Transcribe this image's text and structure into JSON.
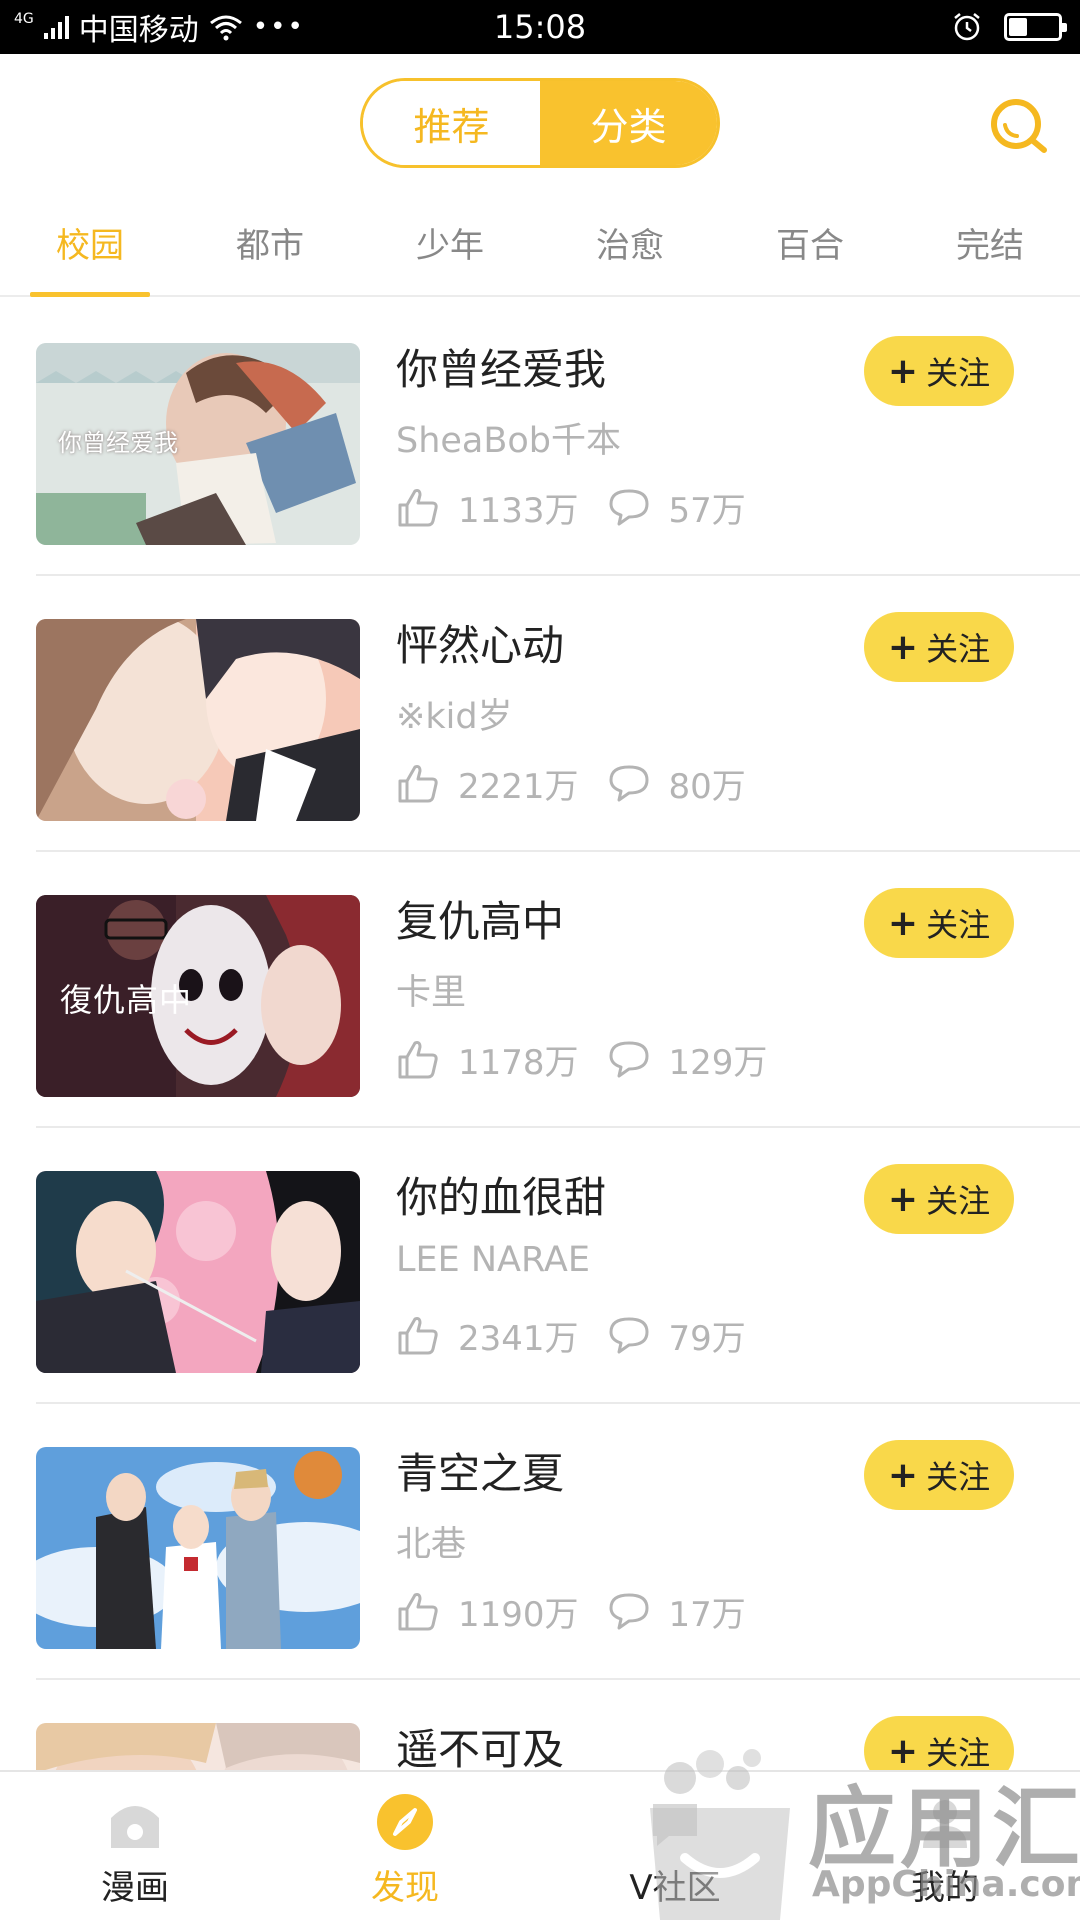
{
  "status_bar": {
    "network": "4G",
    "carrier": "中国移动",
    "dots": "•••",
    "time": "15:08",
    "battery_level": 0.35
  },
  "header": {
    "segments": [
      "推荐",
      "分类"
    ],
    "active_segment": "分类",
    "search_icon": "search-icon"
  },
  "tabs": [
    "校园",
    "都市",
    "少年",
    "治愈",
    "百合",
    "完结"
  ],
  "active_tab": "校园",
  "comics": [
    {
      "title": "你曾经爱我",
      "author": "SheaBob千本",
      "likes": "1133万",
      "comments": "57万",
      "follow": "关注",
      "cover_text": "你曾经爱我"
    },
    {
      "title": "怦然心动",
      "author": "※kid岁",
      "likes": "2221万",
      "comments": "80万",
      "follow": "关注",
      "cover_text": ""
    },
    {
      "title": "复仇高中",
      "author": "卡里",
      "likes": "1178万",
      "comments": "129万",
      "follow": "关注",
      "cover_text": "復仇高中"
    },
    {
      "title": "你的血很甜",
      "author": "LEE NARAE",
      "likes": "2341万",
      "comments": "79万",
      "follow": "关注",
      "cover_text": ""
    },
    {
      "title": "青空之夏",
      "author": "北巷",
      "likes": "1190万",
      "comments": "17万",
      "follow": "关注",
      "cover_text": ""
    },
    {
      "title": "遥不可及",
      "author": "",
      "likes": "",
      "comments": "",
      "follow": "关注",
      "cover_text": ""
    }
  ],
  "bottom_nav": [
    {
      "label": "漫画",
      "icon": "home-icon"
    },
    {
      "label": "发现",
      "icon": "discover-icon"
    },
    {
      "label": "V社区",
      "icon": "community-icon"
    },
    {
      "label": "我的",
      "icon": "profile-icon"
    }
  ],
  "active_nav": "发现",
  "watermark": {
    "main": "应用汇",
    "sub": "AppChina.com"
  },
  "colors": {
    "accent": "#f9c22e",
    "accent_text": "#f5b820",
    "follow_bg": "#f9d84a",
    "muted": "#b4b4b4"
  }
}
